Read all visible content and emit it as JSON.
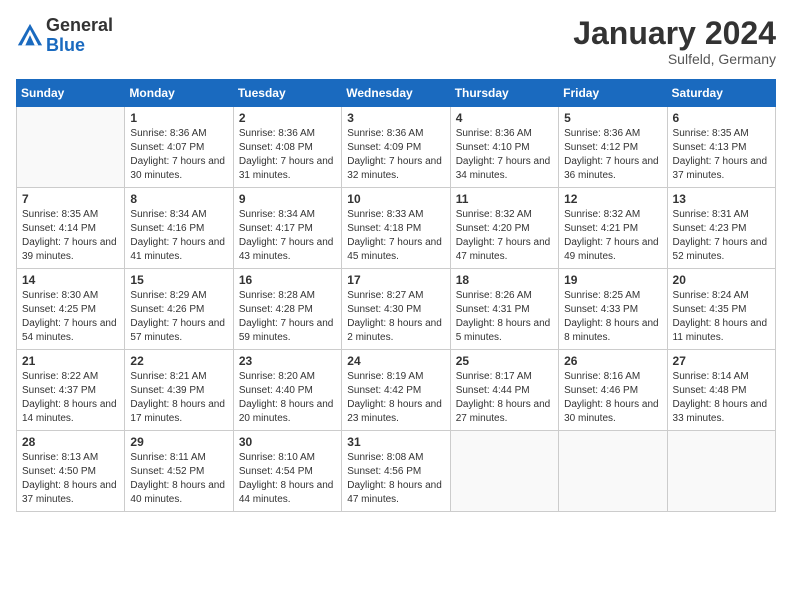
{
  "header": {
    "logo_general": "General",
    "logo_blue": "Blue",
    "month_title": "January 2024",
    "subtitle": "Sulfeld, Germany"
  },
  "days_of_week": [
    "Sunday",
    "Monday",
    "Tuesday",
    "Wednesday",
    "Thursday",
    "Friday",
    "Saturday"
  ],
  "weeks": [
    [
      {
        "day": "",
        "empty": true
      },
      {
        "day": "1",
        "sunrise": "Sunrise: 8:36 AM",
        "sunset": "Sunset: 4:07 PM",
        "daylight": "Daylight: 7 hours and 30 minutes."
      },
      {
        "day": "2",
        "sunrise": "Sunrise: 8:36 AM",
        "sunset": "Sunset: 4:08 PM",
        "daylight": "Daylight: 7 hours and 31 minutes."
      },
      {
        "day": "3",
        "sunrise": "Sunrise: 8:36 AM",
        "sunset": "Sunset: 4:09 PM",
        "daylight": "Daylight: 7 hours and 32 minutes."
      },
      {
        "day": "4",
        "sunrise": "Sunrise: 8:36 AM",
        "sunset": "Sunset: 4:10 PM",
        "daylight": "Daylight: 7 hours and 34 minutes."
      },
      {
        "day": "5",
        "sunrise": "Sunrise: 8:36 AM",
        "sunset": "Sunset: 4:12 PM",
        "daylight": "Daylight: 7 hours and 36 minutes."
      },
      {
        "day": "6",
        "sunrise": "Sunrise: 8:35 AM",
        "sunset": "Sunset: 4:13 PM",
        "daylight": "Daylight: 7 hours and 37 minutes."
      }
    ],
    [
      {
        "day": "7",
        "sunrise": "Sunrise: 8:35 AM",
        "sunset": "Sunset: 4:14 PM",
        "daylight": "Daylight: 7 hours and 39 minutes."
      },
      {
        "day": "8",
        "sunrise": "Sunrise: 8:34 AM",
        "sunset": "Sunset: 4:16 PM",
        "daylight": "Daylight: 7 hours and 41 minutes."
      },
      {
        "day": "9",
        "sunrise": "Sunrise: 8:34 AM",
        "sunset": "Sunset: 4:17 PM",
        "daylight": "Daylight: 7 hours and 43 minutes."
      },
      {
        "day": "10",
        "sunrise": "Sunrise: 8:33 AM",
        "sunset": "Sunset: 4:18 PM",
        "daylight": "Daylight: 7 hours and 45 minutes."
      },
      {
        "day": "11",
        "sunrise": "Sunrise: 8:32 AM",
        "sunset": "Sunset: 4:20 PM",
        "daylight": "Daylight: 7 hours and 47 minutes."
      },
      {
        "day": "12",
        "sunrise": "Sunrise: 8:32 AM",
        "sunset": "Sunset: 4:21 PM",
        "daylight": "Daylight: 7 hours and 49 minutes."
      },
      {
        "day": "13",
        "sunrise": "Sunrise: 8:31 AM",
        "sunset": "Sunset: 4:23 PM",
        "daylight": "Daylight: 7 hours and 52 minutes."
      }
    ],
    [
      {
        "day": "14",
        "sunrise": "Sunrise: 8:30 AM",
        "sunset": "Sunset: 4:25 PM",
        "daylight": "Daylight: 7 hours and 54 minutes."
      },
      {
        "day": "15",
        "sunrise": "Sunrise: 8:29 AM",
        "sunset": "Sunset: 4:26 PM",
        "daylight": "Daylight: 7 hours and 57 minutes."
      },
      {
        "day": "16",
        "sunrise": "Sunrise: 8:28 AM",
        "sunset": "Sunset: 4:28 PM",
        "daylight": "Daylight: 7 hours and 59 minutes."
      },
      {
        "day": "17",
        "sunrise": "Sunrise: 8:27 AM",
        "sunset": "Sunset: 4:30 PM",
        "daylight": "Daylight: 8 hours and 2 minutes."
      },
      {
        "day": "18",
        "sunrise": "Sunrise: 8:26 AM",
        "sunset": "Sunset: 4:31 PM",
        "daylight": "Daylight: 8 hours and 5 minutes."
      },
      {
        "day": "19",
        "sunrise": "Sunrise: 8:25 AM",
        "sunset": "Sunset: 4:33 PM",
        "daylight": "Daylight: 8 hours and 8 minutes."
      },
      {
        "day": "20",
        "sunrise": "Sunrise: 8:24 AM",
        "sunset": "Sunset: 4:35 PM",
        "daylight": "Daylight: 8 hours and 11 minutes."
      }
    ],
    [
      {
        "day": "21",
        "sunrise": "Sunrise: 8:22 AM",
        "sunset": "Sunset: 4:37 PM",
        "daylight": "Daylight: 8 hours and 14 minutes."
      },
      {
        "day": "22",
        "sunrise": "Sunrise: 8:21 AM",
        "sunset": "Sunset: 4:39 PM",
        "daylight": "Daylight: 8 hours and 17 minutes."
      },
      {
        "day": "23",
        "sunrise": "Sunrise: 8:20 AM",
        "sunset": "Sunset: 4:40 PM",
        "daylight": "Daylight: 8 hours and 20 minutes."
      },
      {
        "day": "24",
        "sunrise": "Sunrise: 8:19 AM",
        "sunset": "Sunset: 4:42 PM",
        "daylight": "Daylight: 8 hours and 23 minutes."
      },
      {
        "day": "25",
        "sunrise": "Sunrise: 8:17 AM",
        "sunset": "Sunset: 4:44 PM",
        "daylight": "Daylight: 8 hours and 27 minutes."
      },
      {
        "day": "26",
        "sunrise": "Sunrise: 8:16 AM",
        "sunset": "Sunset: 4:46 PM",
        "daylight": "Daylight: 8 hours and 30 minutes."
      },
      {
        "day": "27",
        "sunrise": "Sunrise: 8:14 AM",
        "sunset": "Sunset: 4:48 PM",
        "daylight": "Daylight: 8 hours and 33 minutes."
      }
    ],
    [
      {
        "day": "28",
        "sunrise": "Sunrise: 8:13 AM",
        "sunset": "Sunset: 4:50 PM",
        "daylight": "Daylight: 8 hours and 37 minutes."
      },
      {
        "day": "29",
        "sunrise": "Sunrise: 8:11 AM",
        "sunset": "Sunset: 4:52 PM",
        "daylight": "Daylight: 8 hours and 40 minutes."
      },
      {
        "day": "30",
        "sunrise": "Sunrise: 8:10 AM",
        "sunset": "Sunset: 4:54 PM",
        "daylight": "Daylight: 8 hours and 44 minutes."
      },
      {
        "day": "31",
        "sunrise": "Sunrise: 8:08 AM",
        "sunset": "Sunset: 4:56 PM",
        "daylight": "Daylight: 8 hours and 47 minutes."
      },
      {
        "day": "",
        "empty": true
      },
      {
        "day": "",
        "empty": true
      },
      {
        "day": "",
        "empty": true
      }
    ]
  ]
}
